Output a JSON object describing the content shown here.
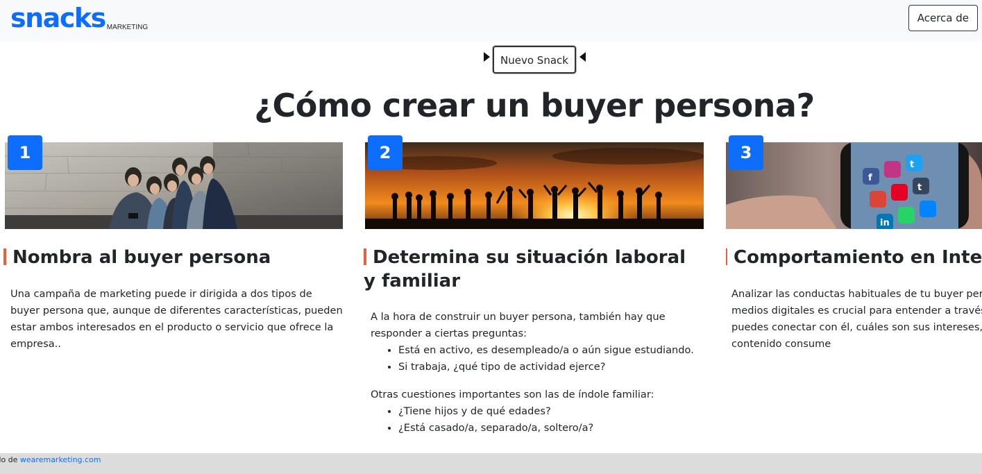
{
  "navbar": {
    "brand_main": "snacks",
    "brand_sub": "MARKETING",
    "about_label": "Acerca de"
  },
  "controls": {
    "new_snack_label": "Nuevo Snack"
  },
  "page": {
    "title": "¿Cómo crear un buyer persona?"
  },
  "cards": [
    {
      "number": "1",
      "heading": "Nombra al buyer persona",
      "image": "group-selfie-photo",
      "text": "Una campaña de marketing puede ir dirigida a dos tipos de buyer persona que, aunque de diferentes características, pueden estar ambos interesados en el producto o servicio que ofrece la empresa.."
    },
    {
      "number": "2",
      "heading": "Determina su situación laboral y familiar",
      "image": "sunset-silhouettes-photo",
      "intro": "A la hora de construir un buyer persona, también hay que responder a ciertas preguntas:",
      "list1": [
        "Está en activo, es desempleado/a o aún sigue estudiando.",
        "Si trabaja, ¿qué tipo de actividad ejerce?"
      ],
      "intro2": "Otras cuestiones importantes son las de índole familiar:",
      "list2": [
        "¿Tiene hijos y de qué edades?",
        "¿Está casado/a, separado/a, soltero/a?"
      ]
    },
    {
      "number": "3",
      "heading": "Comportamiento en Internet",
      "image": "smartphone-social-apps-photo",
      "text": "Analizar las conductas habituales de tu buyer persona en los medios digitales es crucial para entender a través de qué canales puedes conectar con él, cuáles son sus intereses, qué tipo de contenido consume"
    }
  ],
  "footer": {
    "prefix": "mado de ",
    "link_text": "wearemarketing.com"
  },
  "colors": {
    "brand": "#0d6efd",
    "accent_bar": "#e8603c",
    "footer_bg": "#dcdcdc"
  }
}
